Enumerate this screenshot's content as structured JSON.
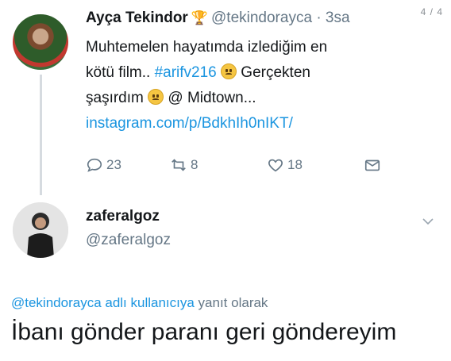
{
  "page_counter": "4 / 4",
  "tweet": {
    "name": "Ayça Tekindor",
    "handle": "@tekindorayca",
    "separator": "·",
    "time": "3sa",
    "line1": "Muhtemelen hayatımda izlediğim en",
    "line2_a": "kötü film.. ",
    "hashtag": "#arifv216",
    "line2_b": " Gerçekten",
    "line3_a": "şaşırdım ",
    "line3_b": " @ Midtown...",
    "link": "instagram.com/p/BdkhIh0nIKT/",
    "stats": {
      "replies": "23",
      "retweets": "8",
      "likes": "18"
    }
  },
  "reply": {
    "name": "zaferalgoz",
    "handle": "@zaferalgoz",
    "reply_to_user": "@tekindorayca adlı kullanıcıya",
    "reply_to_suffix": " yanıt olarak",
    "text": "İbanı gönder paranı geri göndereyim"
  },
  "icons": [
    "trophy-icon",
    "sad-face-emoji",
    "worried-face-emoji",
    "reply-icon",
    "retweet-icon",
    "like-icon",
    "mail-icon",
    "chevron-down-icon"
  ],
  "colors": {
    "link": "#1b95e0",
    "muted": "#657786"
  }
}
